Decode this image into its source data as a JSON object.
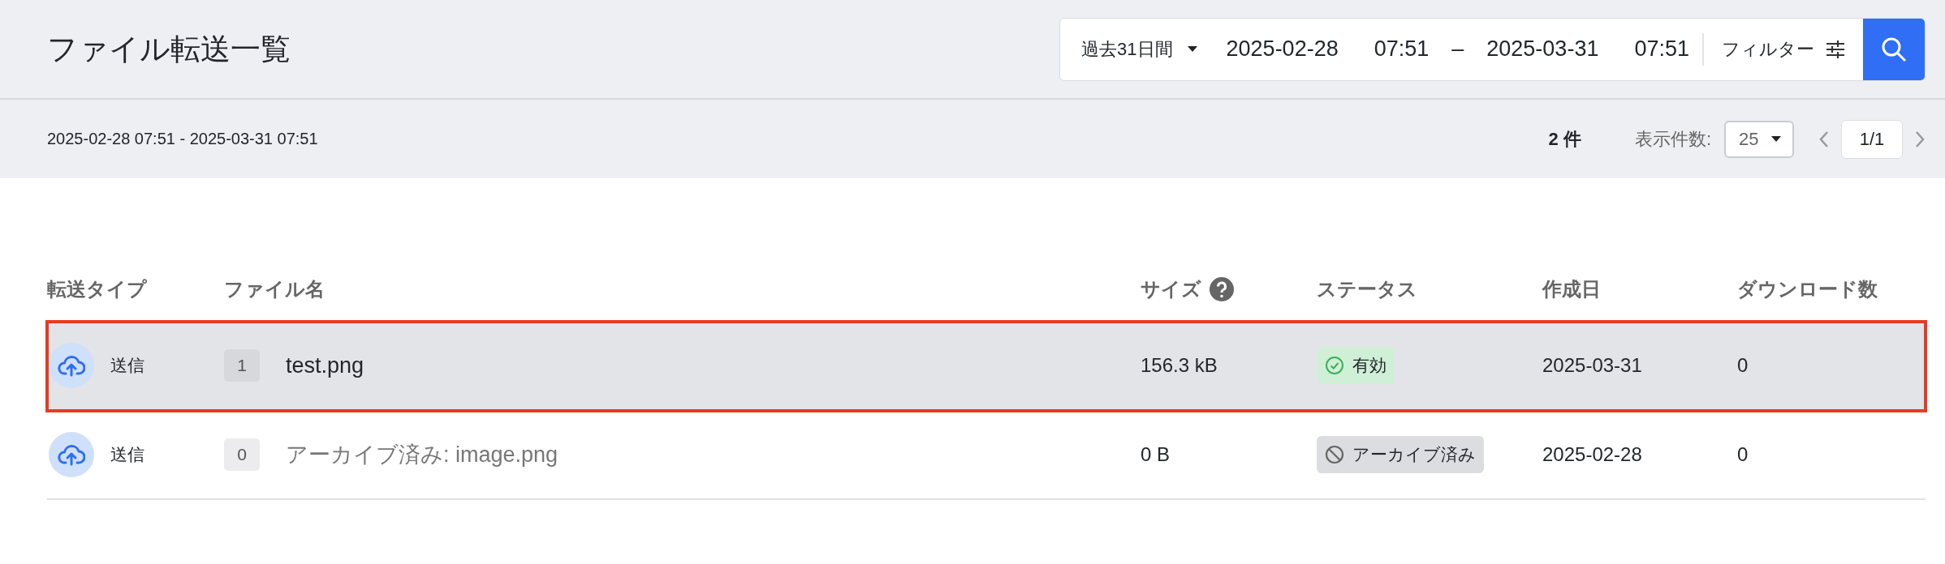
{
  "page_title": "ファイル転送一覧",
  "filter_bar": {
    "range": "過去31日間",
    "start_date": "2025-02-28",
    "start_time": "07:51",
    "separator": "–",
    "end_date": "2025-03-31",
    "end_time": "07:51",
    "filter_label": "フィルター"
  },
  "summary": {
    "period": "2025-02-28 07:51 - 2025-03-31 07:51",
    "count": "2 件",
    "page_size_label": "表示件数:",
    "page_size": "25",
    "page": "1/1"
  },
  "table": {
    "columns": [
      "転送タイプ",
      "ファイル名",
      "サイズ",
      "ステータス",
      "作成日",
      "ダウンロード数"
    ],
    "rows": [
      {
        "selected": true,
        "type": "送信",
        "downloads_badge": "1",
        "file_name": "test.png",
        "size": "156.3 kB",
        "status": {
          "kind": "active",
          "label": "有効"
        },
        "created": "2025-03-31",
        "download_count": "0"
      },
      {
        "selected": false,
        "type": "送信",
        "downloads_badge": "0",
        "file_name": "アーカイブ済み: image.png",
        "size": "0 B",
        "status": {
          "kind": "archived",
          "label": "アーカイブ済み"
        },
        "created": "2025-02-28",
        "download_count": "0"
      }
    ]
  }
}
